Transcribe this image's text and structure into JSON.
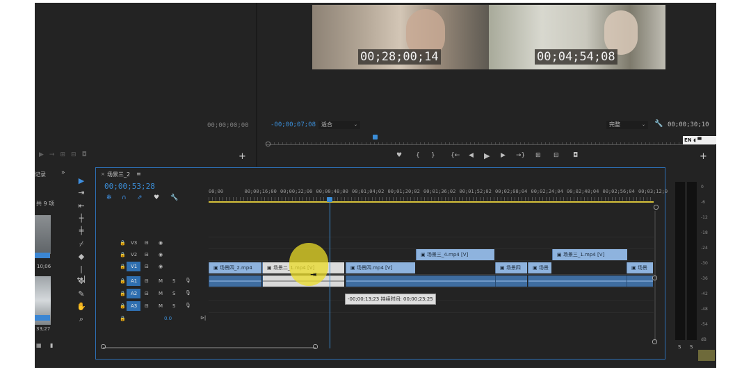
{
  "source_monitor": {
    "timecode": "00;00;00;00"
  },
  "program_monitor": {
    "overlay_left": "00;28;00;14",
    "overlay_right": "00;04;54;08",
    "current_time": "-00;00;07;08",
    "fit_label": "适合",
    "quality_label": "完整",
    "duration": "00;00;30;10",
    "lang_badge": "EN"
  },
  "project_panel": {
    "tab_label": "记录",
    "count_label": "共 9 项",
    "thumb_time_1": "10;06",
    "thumb_time_2": "33;27"
  },
  "timeline": {
    "sequence_name": "场景三_2",
    "playhead_time": "00;00;53;28",
    "ruler_labels": [
      "00;00",
      "00;00;16;00",
      "00;00;32;00",
      "00;00;48;00",
      "00;01;04;02",
      "00;01;20;02",
      "00;01;36;02",
      "00;01;52;02",
      "00;02;08;04",
      "00;02;24;04",
      "00;02;40;04",
      "00;02;56;04",
      "00;03;12;0"
    ],
    "tracks": {
      "v3": "V3",
      "v2": "V2",
      "v1": "V1",
      "a1": "A1",
      "a2": "A2",
      "a3": "A3",
      "master_value": "0.0"
    },
    "clips": {
      "v2_clip1": "场景三_4.mp4 [V]",
      "v2_clip2": "场景三_1.mp4 [V]",
      "v1_clip1": "场景四_2.mp4",
      "v1_clip2": "场景二_1.mp4 [V]",
      "v1_clip3": "场景四.mp4 [V]",
      "v1_clip4": "场景四",
      "v1_clip5": "场景",
      "v1_clip6": "场景"
    },
    "tooltip": "-00;00;13;23  持续时间: 00;00;23;25"
  },
  "audio_meter": {
    "labels": [
      "0",
      "-6",
      "-12",
      "-18",
      "-24",
      "-30",
      "-36",
      "-42",
      "-48",
      "-54",
      "dB"
    ],
    "solo_left": "S",
    "solo_right": "S"
  }
}
